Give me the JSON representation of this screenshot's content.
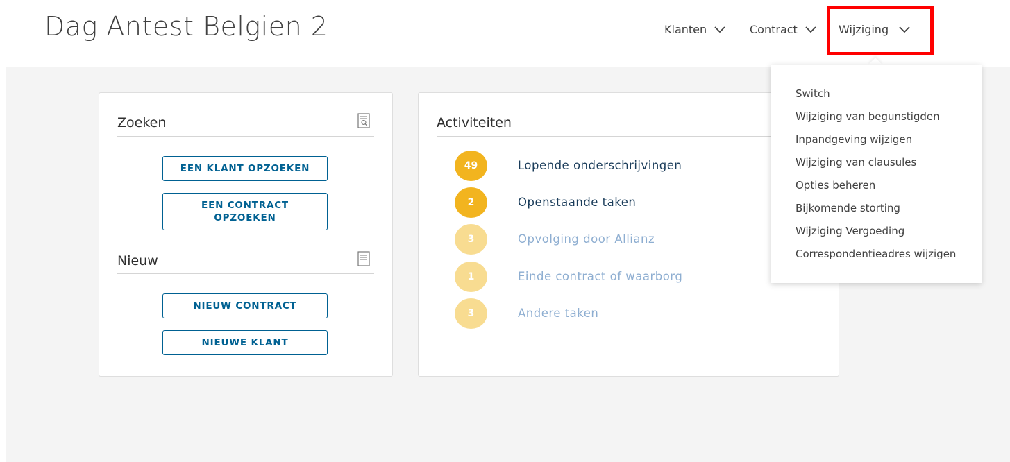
{
  "app": {
    "title": "Dag Antest Belgien 2"
  },
  "nav": [
    {
      "label": "Klanten"
    },
    {
      "label": "Contract"
    },
    {
      "label": "Wijziging"
    }
  ],
  "search_card": {
    "title": "Zoeken",
    "buttons": [
      "EEN KLANT OPZOEKEN",
      "EEN CONTRACT OPZOEKEN"
    ],
    "new_title": "Nieuw",
    "new_buttons": [
      "NIEUW CONTRACT",
      "NIEUWE KLANT"
    ]
  },
  "activities": {
    "title": "Activiteiten",
    "items": [
      {
        "count": "49",
        "label": "Lopende onderschrijvingen",
        "state": "active"
      },
      {
        "count": "2",
        "label": "Openstaande taken",
        "state": "active"
      },
      {
        "count": "3",
        "label": "Opvolging door Allianz",
        "state": "inactive"
      },
      {
        "count": "1",
        "label": "Einde contract of waarborg",
        "state": "inactive"
      },
      {
        "count": "3",
        "label": "Andere taken",
        "state": "inactive"
      }
    ]
  },
  "dropdown": {
    "items": [
      "Switch",
      "Wijziging van begunstigden",
      "Inpandgeving wijzigen",
      "Wijziging van clausules",
      "Opties beheren",
      "Bijkomende storting",
      "Wijziging Vergoeding",
      "Correspondentieadres wijzigen"
    ]
  },
  "colors": {
    "primary": "#006192",
    "badge_active": "#f2b41f",
    "badge_inactive": "#f8dc91",
    "highlight": "#ff0000"
  }
}
